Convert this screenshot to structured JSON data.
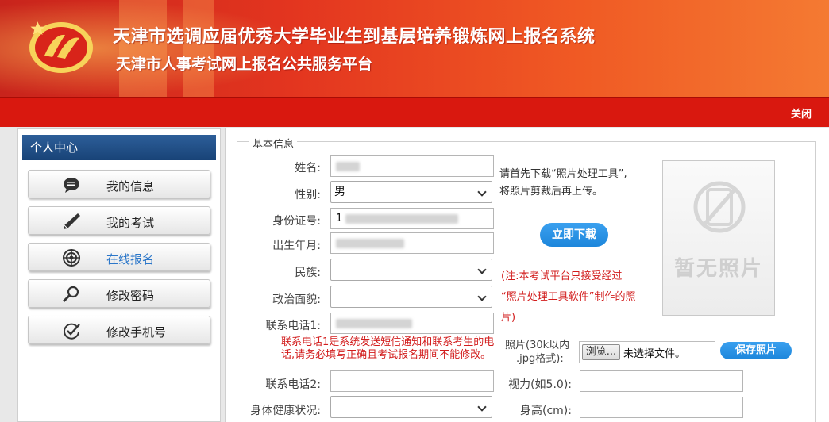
{
  "header": {
    "title": "天津市选调应届优秀大学毕业生到基层培养锻炼网上报名系统",
    "subtitle": "天津市人事考试网上报名公共服务平台",
    "close_label": "关闭"
  },
  "sidebar": {
    "title": "个人中心",
    "items": [
      {
        "label": "我的信息",
        "icon": "chat-bubble-icon"
      },
      {
        "label": "我的考试",
        "icon": "pen-icon"
      },
      {
        "label": "在线报名",
        "icon": "target-icon",
        "active": true
      },
      {
        "label": "修改密码",
        "icon": "magnifier-icon"
      },
      {
        "label": "修改手机号",
        "icon": "check-circle-icon"
      }
    ]
  },
  "form": {
    "legend": "基本信息",
    "name_label": "姓名:",
    "gender_label": "性别:",
    "gender_value": "男",
    "id_label": "身份证号:",
    "id_value_prefix": "1",
    "birth_label": "出生年月:",
    "ethnicity_label": "民族:",
    "political_label": "政治面貌:",
    "phone1_label": "联系电话1:",
    "phone1_note_line1": "联系电话1是系统发送短信通知和联系考生的电",
    "phone1_note_line2": "话,请务必填写正确且考试报名期间不能修改。",
    "phone2_label": "联系电话2:",
    "health_label": "身体健康状况:",
    "vision_label": "视力(如5.0):",
    "height_label": "身高(cm):"
  },
  "photo": {
    "tip_line1": "请首先下载“照片处理工具”,",
    "tip_line2": "将照片剪裁后再上传。",
    "download_button": "立即下载",
    "warn_line1": "(注:本考试平台只接受经过",
    "warn_line2": "“照片处理工具软件”制作的照",
    "warn_line3": "片)",
    "placeholder": "暂无照片",
    "photo_label_line1": "照片(30k以内",
    "photo_label_line2": ".jpg格式):",
    "browse_button": "浏览...",
    "file_status": "未选择文件。",
    "save_button": "保存照片"
  },
  "colors": {
    "header_red": "#d9180f",
    "sidebar_head_blue": "#1f4c85",
    "button_blue": "#2a92e4",
    "warning_red": "#d21c1c",
    "active_link": "#2c77c9"
  }
}
